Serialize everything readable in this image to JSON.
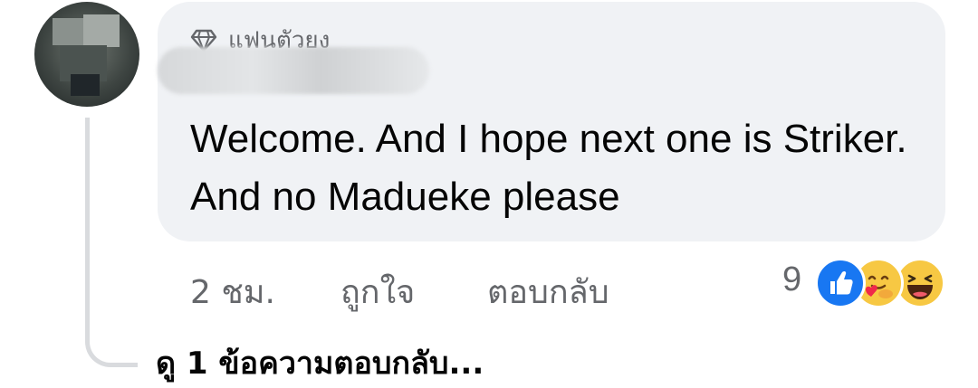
{
  "comment": {
    "badge_label": "แฟนตัวยง",
    "text": "Welcome. And I hope next one is Striker. And no Madueke please",
    "time": "2 ชม.",
    "like_label": "ถูกใจ",
    "reply_label": "ตอบกลับ",
    "reaction_count": "9",
    "reactions": [
      "like-icon",
      "care-icon",
      "haha-icon"
    ]
  },
  "replies": {
    "view_label": "ดู 1 ข้อความตอบกลับ..."
  },
  "colors": {
    "bubble": "#f0f2f5",
    "secondary_text": "#65676b",
    "primary_text": "#050505",
    "like_blue": "#1877f2",
    "emoji_yellow": "#f7c843",
    "thread_line": "#d9dbde"
  }
}
